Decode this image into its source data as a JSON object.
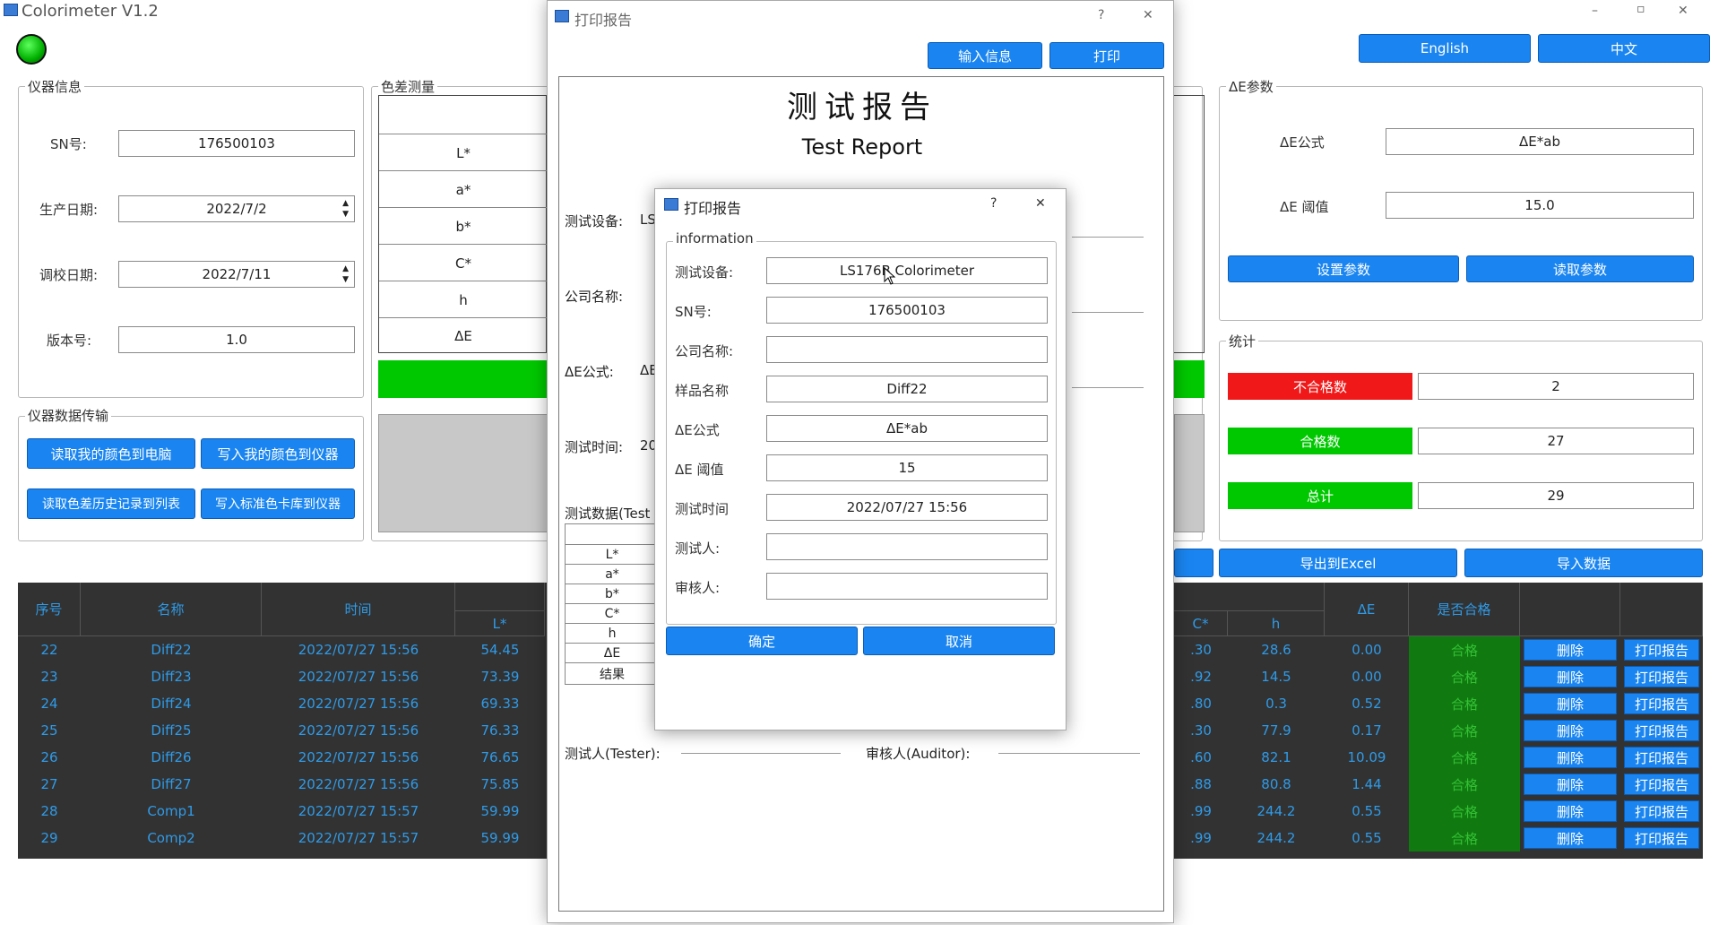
{
  "window": {
    "title": "Colorimeter V1.2",
    "minimize": "–",
    "maximize": "▫",
    "close": "✕"
  },
  "lang": {
    "english": "English",
    "chinese": "中文"
  },
  "device_info": {
    "title": "仪器信息",
    "sn_label": "SN号:",
    "sn_value": "176500103",
    "prod_date_label": "生产日期:",
    "prod_date_value": "2022/7/2",
    "cal_date_label": "调校日期:",
    "cal_date_value": "2022/7/11",
    "version_label": "版本号:",
    "version_value": "1.0"
  },
  "transfer": {
    "title": "仪器数据传输",
    "btn1": "读取我的颜色到电脑",
    "btn2": "写入我的颜色到仪器",
    "btn3": "读取色差历史记录到列表",
    "btn4": "写入标准色卡库到仪器"
  },
  "measure": {
    "title": "色差测量",
    "rows": [
      "L*",
      "a*",
      "b*",
      "C*",
      "h",
      "ΔE"
    ]
  },
  "de_params": {
    "title": "ΔE参数",
    "formula_label": "ΔE公式",
    "formula_value": "ΔE*ab",
    "threshold_label": "ΔE 阈值",
    "threshold_value": "15.0",
    "set_btn": "设置参数",
    "read_btn": "读取参数"
  },
  "stats": {
    "title": "统计",
    "fail_label": "不合格数",
    "fail_value": "2",
    "pass_label": "合格数",
    "pass_value": "27",
    "total_label": "总计",
    "total_value": "29"
  },
  "export_btn": "导出到Excel",
  "import_btn": "导入数据",
  "table": {
    "headers": {
      "index": "序号",
      "name": "名称",
      "time": "时间",
      "L": "L*",
      "C": "C*",
      "h": "h",
      "dE": "ΔE",
      "pass": "是否合格"
    },
    "rows": [
      {
        "index": "22",
        "name": "Diff22",
        "time": "2022/07/27 15:56",
        "L": "54.45",
        "C": ".30",
        "h": "28.6",
        "dE": "0.00",
        "pass": "合格",
        "del": "删除",
        "print": "打印报告"
      },
      {
        "index": "23",
        "name": "Diff23",
        "time": "2022/07/27 15:56",
        "L": "73.39",
        "C": ".92",
        "h": "14.5",
        "dE": "0.00",
        "pass": "合格",
        "del": "删除",
        "print": "打印报告"
      },
      {
        "index": "24",
        "name": "Diff24",
        "time": "2022/07/27 15:56",
        "L": "69.33",
        "C": ".80",
        "h": "0.3",
        "dE": "0.52",
        "pass": "合格",
        "del": "删除",
        "print": "打印报告"
      },
      {
        "index": "25",
        "name": "Diff25",
        "time": "2022/07/27 15:56",
        "L": "76.33",
        "C": ".30",
        "h": "77.9",
        "dE": "0.17",
        "pass": "合格",
        "del": "删除",
        "print": "打印报告"
      },
      {
        "index": "26",
        "name": "Diff26",
        "time": "2022/07/27 15:56",
        "L": "76.65",
        "C": ".60",
        "h": "82.1",
        "dE": "10.09",
        "pass": "合格",
        "del": "删除",
        "print": "打印报告"
      },
      {
        "index": "27",
        "name": "Diff27",
        "time": "2022/07/27 15:56",
        "L": "75.85",
        "C": ".88",
        "h": "80.8",
        "dE": "1.44",
        "pass": "合格",
        "del": "删除",
        "print": "打印报告"
      },
      {
        "index": "28",
        "name": "Comp1",
        "time": "2022/07/27 15:57",
        "L": "59.99",
        "C": ".99",
        "h": "244.2",
        "dE": "0.55",
        "pass": "合格",
        "del": "删除",
        "print": "打印报告"
      },
      {
        "index": "29",
        "name": "Comp2",
        "time": "2022/07/27 15:57",
        "L": "59.99",
        "C": ".99",
        "h": "244.2",
        "dE": "0.55",
        "pass": "合格",
        "del": "删除",
        "print": "打印报告"
      }
    ]
  },
  "report": {
    "win_title": "打印报告",
    "help": "?",
    "close": "✕",
    "input_btn": "输入信息",
    "print_btn": "打印",
    "title_cn": "测试报告",
    "title_en": "Test Report",
    "device_label": "测试设备:",
    "device_partial": "LS",
    "company_label": "公司名称:",
    "formula_label": "ΔE公式:",
    "formula_partial": "ΔE",
    "time_label": "测试时间:",
    "time_partial": "20",
    "data_label": "测试数据(Test",
    "data_rows": [
      "L*",
      "a*",
      "b*",
      "C*",
      "h",
      "ΔE",
      "结果"
    ],
    "tester_label": "测试人(Tester):",
    "auditor_label": "审核人(Auditor):"
  },
  "dialog": {
    "title": "打印报告",
    "help": "?",
    "close": "✕",
    "group": "information",
    "device_label": "测试设备:",
    "device_value": "LS176B Colorimeter",
    "sn_label": "SN号:",
    "sn_value": "176500103",
    "company_label": "公司名称:",
    "company_value": "",
    "sample_label": "样品名称",
    "sample_value": "Diff22",
    "formula_label": "ΔE公式",
    "formula_value": "ΔE*ab",
    "threshold_label": "ΔE 阈值",
    "threshold_value": "15",
    "time_label": "测试时间",
    "time_value": "2022/07/27 15:56",
    "tester_label": "测试人:",
    "tester_value": "",
    "auditor_label": "审核人:",
    "auditor_value": "",
    "ok": "确定",
    "cancel": "取消"
  },
  "colors": {
    "accent": "#1a85f0",
    "pass_green": "#00c800",
    "fail_red": "#f01818",
    "table_bg": "#323232"
  }
}
